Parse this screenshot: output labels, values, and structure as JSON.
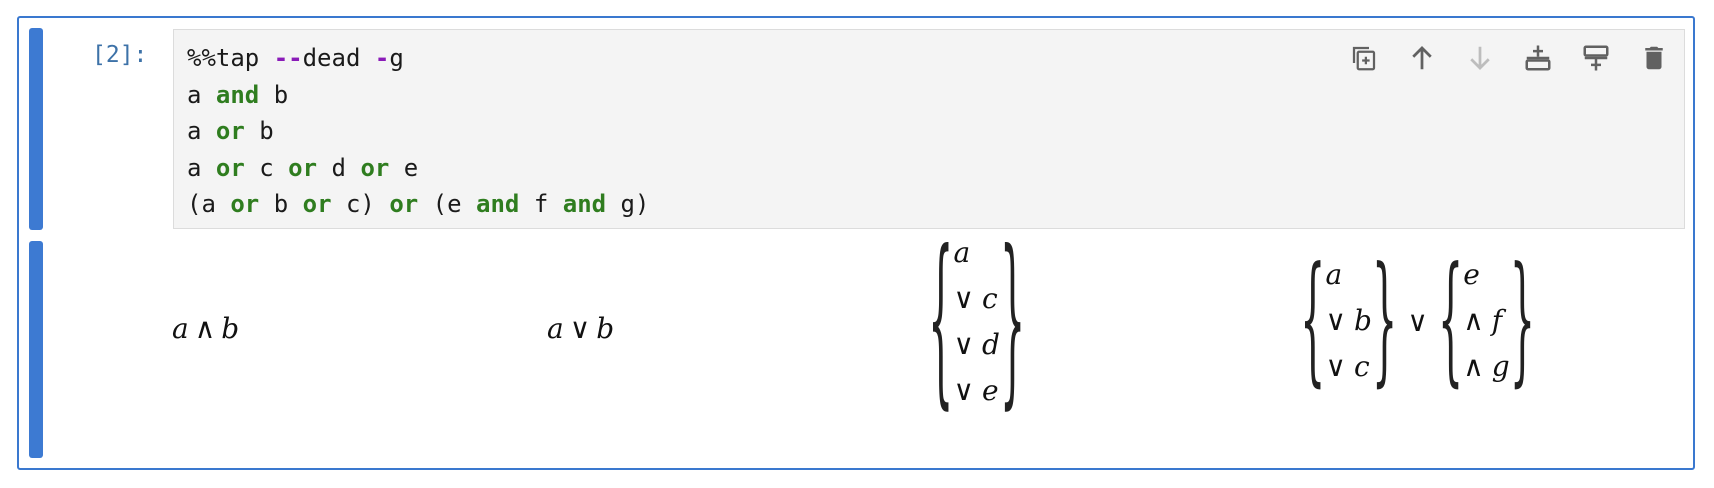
{
  "cell": {
    "prompt": "[2]:",
    "code_lines": [
      [
        {
          "t": "%%tap ",
          "c": "plain"
        },
        {
          "t": "--",
          "c": "op"
        },
        {
          "t": "dead ",
          "c": "plain"
        },
        {
          "t": "-",
          "c": "op"
        },
        {
          "t": "g",
          "c": "plain"
        }
      ],
      [
        {
          "t": "a ",
          "c": "plain"
        },
        {
          "t": "and",
          "c": "kw"
        },
        {
          "t": " b",
          "c": "plain"
        }
      ],
      [
        {
          "t": "a ",
          "c": "plain"
        },
        {
          "t": "or",
          "c": "kw"
        },
        {
          "t": " b",
          "c": "plain"
        }
      ],
      [
        {
          "t": "a ",
          "c": "plain"
        },
        {
          "t": "or",
          "c": "kw"
        },
        {
          "t": " c ",
          "c": "plain"
        },
        {
          "t": "or",
          "c": "kw"
        },
        {
          "t": " d ",
          "c": "plain"
        },
        {
          "t": "or",
          "c": "kw"
        },
        {
          "t": " e",
          "c": "plain"
        }
      ],
      [
        {
          "t": "(a ",
          "c": "plain"
        },
        {
          "t": "or",
          "c": "kw"
        },
        {
          "t": " b ",
          "c": "plain"
        },
        {
          "t": "or",
          "c": "kw"
        },
        {
          "t": " c) ",
          "c": "plain"
        },
        {
          "t": "or",
          "c": "kw"
        },
        {
          "t": " (e ",
          "c": "plain"
        },
        {
          "t": "and",
          "c": "kw"
        },
        {
          "t": " f ",
          "c": "plain"
        },
        {
          "t": "and",
          "c": "kw"
        },
        {
          "t": " g)",
          "c": "plain"
        }
      ]
    ],
    "toolbar": [
      {
        "name": "duplicate-cell-button",
        "icon": "copy-icon"
      },
      {
        "name": "move-up-button",
        "icon": "arrow-up-icon"
      },
      {
        "name": "move-down-button",
        "icon": "arrow-down-icon"
      },
      {
        "name": "insert-above-button",
        "icon": "insert-above-icon"
      },
      {
        "name": "insert-below-button",
        "icon": "insert-below-icon"
      },
      {
        "name": "delete-cell-button",
        "icon": "trash-icon"
      }
    ]
  },
  "outputs": {
    "expr1": {
      "a": "a",
      "op": "∧",
      "b": "b"
    },
    "expr2": {
      "a": "a",
      "op": "∨",
      "b": "b"
    },
    "expr3": {
      "rows": [
        [
          "",
          "a"
        ],
        [
          "∨",
          "c"
        ],
        [
          "∨",
          "d"
        ],
        [
          "∨",
          "e"
        ]
      ]
    },
    "expr4": {
      "left": [
        [
          "",
          "a"
        ],
        [
          "∨",
          "b"
        ],
        [
          "∨",
          "c"
        ]
      ],
      "join": "∨",
      "right": [
        [
          "",
          "e"
        ],
        [
          "∧",
          "f"
        ],
        [
          "∧",
          "g"
        ]
      ]
    }
  },
  "colors": {
    "accent": "#3d7ad2",
    "keyword": "#2f7d1f",
    "operator": "#8a1bb8",
    "prompt": "#3d72a8"
  }
}
